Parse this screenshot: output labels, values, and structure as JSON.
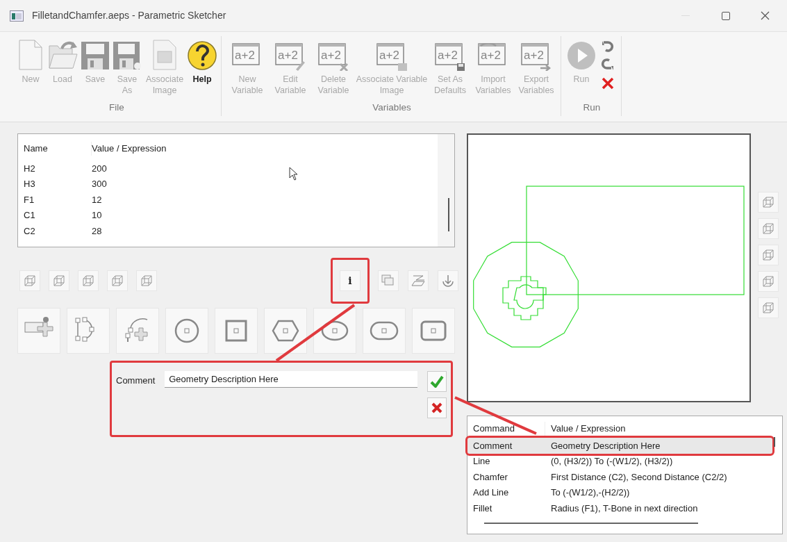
{
  "window": {
    "title": "FilletandChamfer.aeps - Parametric Sketcher"
  },
  "ribbon": {
    "groups": [
      {
        "label": "File",
        "buttons": [
          {
            "kind": "new",
            "label": "New",
            "disabled": true
          },
          {
            "kind": "load",
            "label": "Load",
            "disabled": true
          },
          {
            "kind": "save",
            "label": "Save",
            "disabled": true
          },
          {
            "kind": "saveas",
            "label": "Save As",
            "disabled": true
          },
          {
            "kind": "image",
            "label": "Associate Image",
            "disabled": true
          },
          {
            "kind": "help",
            "label": "Help",
            "disabled": false
          }
        ]
      },
      {
        "label": "Variables",
        "buttons": [
          {
            "kind": "var-new",
            "icon_text": "a+2",
            "label": "New Variable",
            "disabled": true
          },
          {
            "kind": "var-edit",
            "icon_text": "a+2",
            "label": "Edit Variable",
            "disabled": true
          },
          {
            "kind": "var-delete",
            "icon_text": "a+2",
            "label": "Delete Variable",
            "disabled": true
          },
          {
            "kind": "var-image",
            "icon_text": "a+2",
            "label": "Associate Variable Image",
            "disabled": true
          },
          {
            "kind": "var-defaults",
            "icon_text": "a+2",
            "label": "Set As Defaults",
            "disabled": true
          },
          {
            "kind": "var-import",
            "icon_text": "a+2",
            "label": "Import Variables",
            "disabled": true
          },
          {
            "kind": "var-export",
            "icon_text": "a+2",
            "label": "Export Variables",
            "disabled": true
          }
        ]
      },
      {
        "label": "Run",
        "buttons": [
          {
            "kind": "run",
            "label": "Run",
            "disabled": true
          },
          {
            "kind": "stack",
            "disabled": false
          }
        ]
      }
    ]
  },
  "variables": {
    "columns": [
      "Name",
      "Value / Expression"
    ],
    "rows": [
      [
        "H2",
        "200"
      ],
      [
        "H3",
        "300"
      ],
      [
        "F1",
        "12"
      ],
      [
        "C1",
        "10"
      ],
      [
        "C2",
        "28"
      ]
    ]
  },
  "info_button": {
    "label": "i",
    "highlighted": true
  },
  "comment_editor": {
    "label": "Comment",
    "value": "Geometry Description Here",
    "highlighted": true
  },
  "commands": {
    "columns": [
      "Command",
      "Value / Expression"
    ],
    "rows": [
      {
        "cells": [
          "Comment",
          "Geometry Description Here"
        ],
        "selected": true,
        "highlighted": true
      },
      {
        "cells": [
          "Line",
          "(0, (H3/2)) To (-(W1/2), (H3/2))"
        ],
        "selected": false,
        "highlighted": false
      },
      {
        "cells": [
          "Chamfer",
          "First Distance (C2), Second Distance (C2/2)"
        ],
        "selected": false,
        "highlighted": false
      },
      {
        "cells": [
          "Add Line",
          "To (-(W1/2),-(H2/2))"
        ],
        "selected": false,
        "highlighted": false
      },
      {
        "cells": [
          "Fillet",
          "Radius (F1), T-Bone in next direction"
        ],
        "selected": false,
        "highlighted": false
      }
    ]
  }
}
